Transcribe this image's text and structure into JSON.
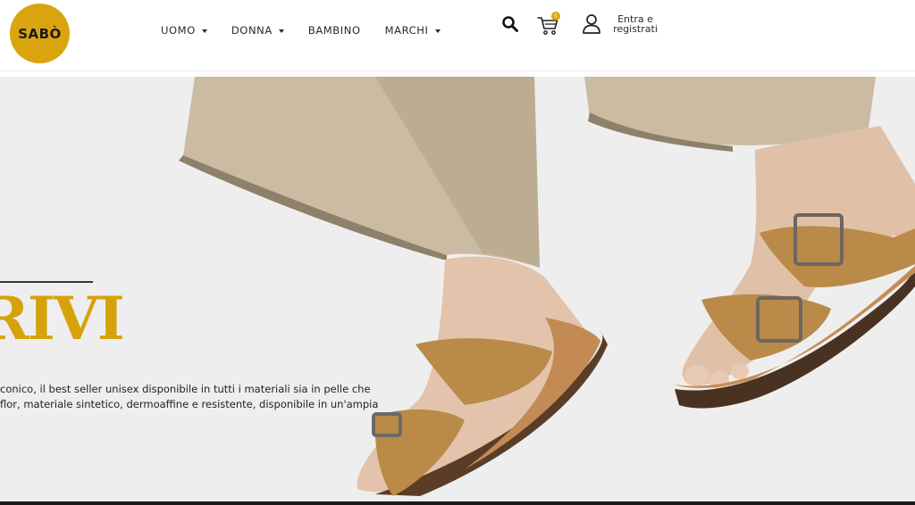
{
  "header": {
    "logo_text": "SABÒ",
    "nav": [
      {
        "label": "UOMO",
        "has_dropdown": true
      },
      {
        "label": "DONNA",
        "has_dropdown": true
      },
      {
        "label": "BAMBINO",
        "has_dropdown": false
      },
      {
        "label": "MARCHI",
        "has_dropdown": true
      }
    ],
    "cart_count": "0",
    "login_line1": "Entra e",
    "login_line2": "registrati",
    "icons": [
      "search-icon",
      "cart-icon",
      "user-icon",
      "chevron-down-icon"
    ]
  },
  "hero": {
    "title": "RIVI",
    "description_line1": "conico, il best seller unisex disponibile in tutti i materiali sia in pelle che",
    "description_line2": "flor, materiale sintetico, dermoaffine e resistente, disponibile in un'ampia"
  },
  "colors": {
    "brand": "#d9a40e",
    "hero_background": "#efeeee",
    "text": "#222222"
  }
}
